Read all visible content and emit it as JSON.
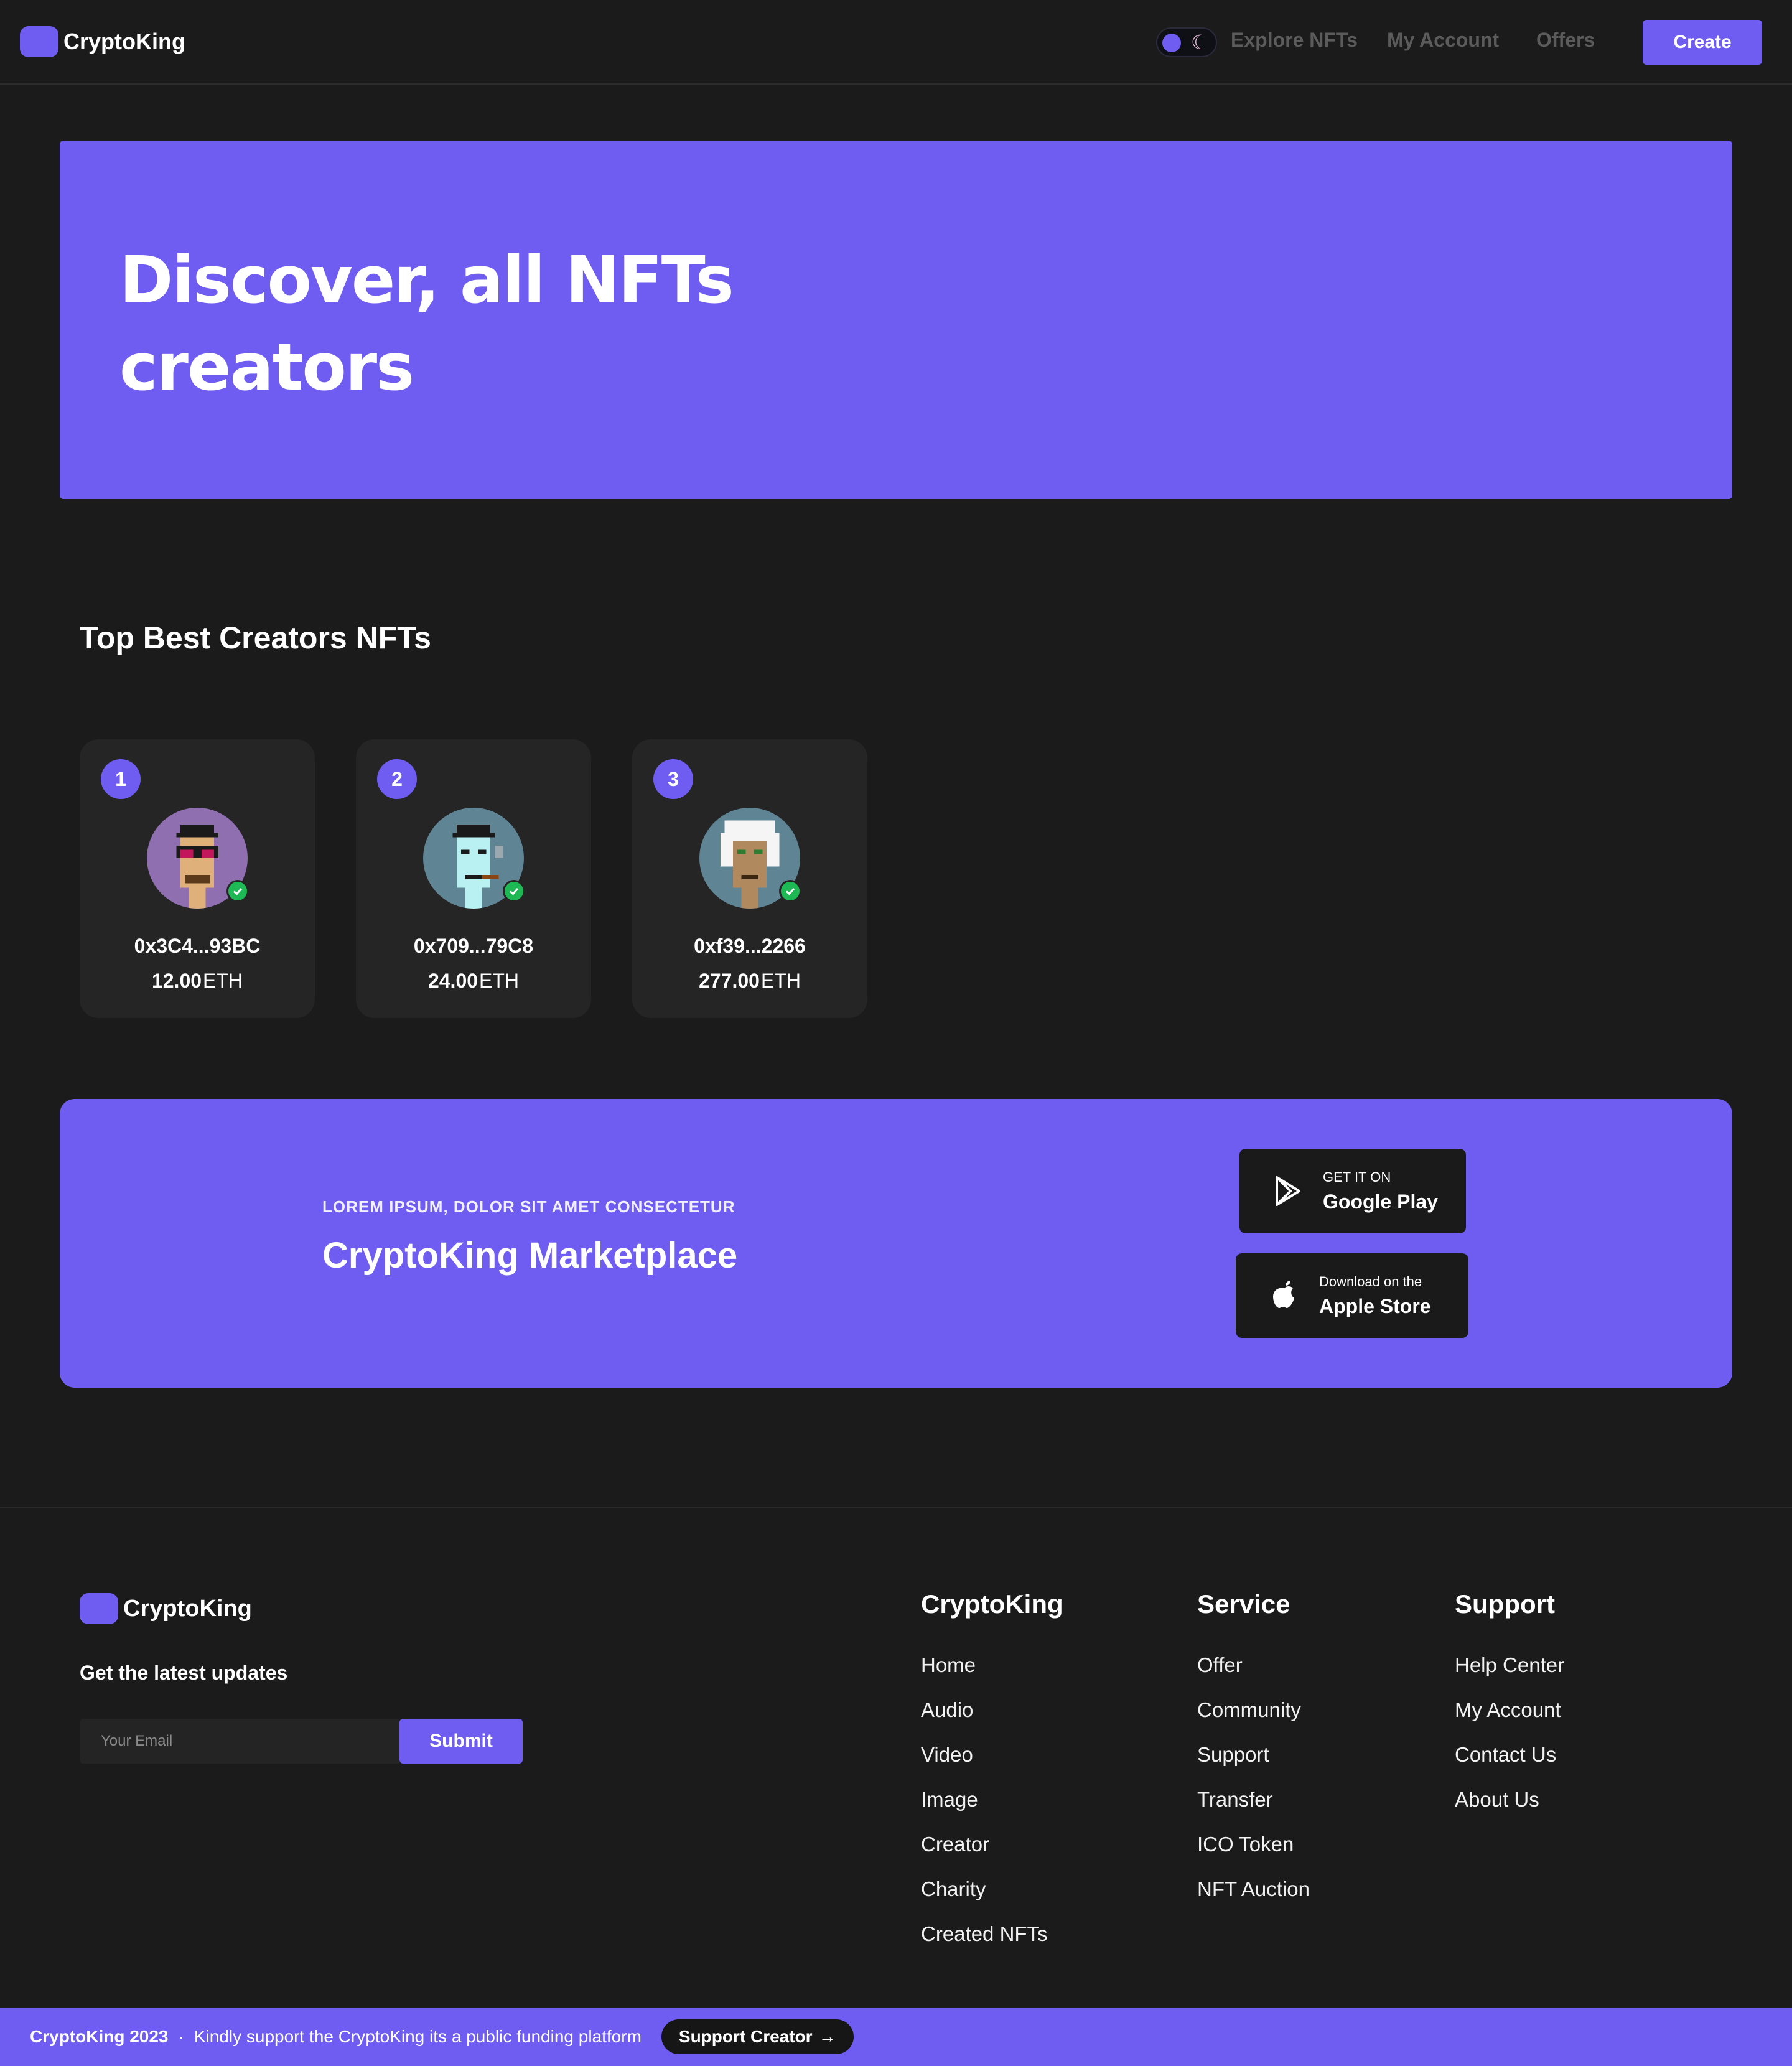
{
  "brand": "CryptoKing",
  "nav": {
    "links": [
      "Explore NFTs",
      "My Account",
      "Offers"
    ],
    "create_label": "Create",
    "theme_toggle_icon": "moon-icon"
  },
  "hero": {
    "line1": "Discover, all NFTs",
    "line2": "creators"
  },
  "creators": {
    "title": "Top Best Creators NFTs",
    "items": [
      {
        "rank": "1",
        "name": "0x3C4...93BC",
        "amount": "12.00",
        "currency": "ETH",
        "verified": true
      },
      {
        "rank": "2",
        "name": "0x709...79C8",
        "amount": "24.00",
        "currency": "ETH",
        "verified": true
      },
      {
        "rank": "3",
        "name": "0xf39...2266",
        "amount": "277.00",
        "currency": "ETH",
        "verified": true
      }
    ]
  },
  "banner": {
    "eyebrow": "LOREM IPSUM, DOLOR SIT AMET CONSECTETUR",
    "title": "CryptoKing Marketplace",
    "google": {
      "small": "GET IT ON",
      "big": "Google Play",
      "icon": "google-play-icon"
    },
    "apple": {
      "small": "Download on the",
      "big": "Apple Store",
      "icon": "apple-icon"
    }
  },
  "footer": {
    "brand": "CryptoKing",
    "updates_label": "Get the latest updates",
    "email_placeholder": "Your Email",
    "submit_label": "Submit",
    "columns": [
      {
        "title": "CryptoKing",
        "links": [
          "Home",
          "Audio",
          "Video",
          "Image",
          "Creator",
          "Charity",
          "Created NFTs"
        ]
      },
      {
        "title": "Service",
        "links": [
          "Offer",
          "Community",
          "Support",
          "Transfer",
          "ICO Token",
          "NFT Auction"
        ]
      },
      {
        "title": "Support",
        "links": [
          "Help Center",
          "My Account",
          "Contact Us",
          "About Us"
        ]
      }
    ]
  },
  "bottom_bar": {
    "brand_year": "CryptoKing 2023",
    "separator": "·",
    "message": "Kindly support the CryptoKing its a public funding platform",
    "button_label": "Support Creator",
    "button_arrow": "→"
  },
  "colors": {
    "accent": "#6f5df1",
    "background": "#1b1b1b",
    "card": "#252525",
    "verified": "#1eb854"
  }
}
